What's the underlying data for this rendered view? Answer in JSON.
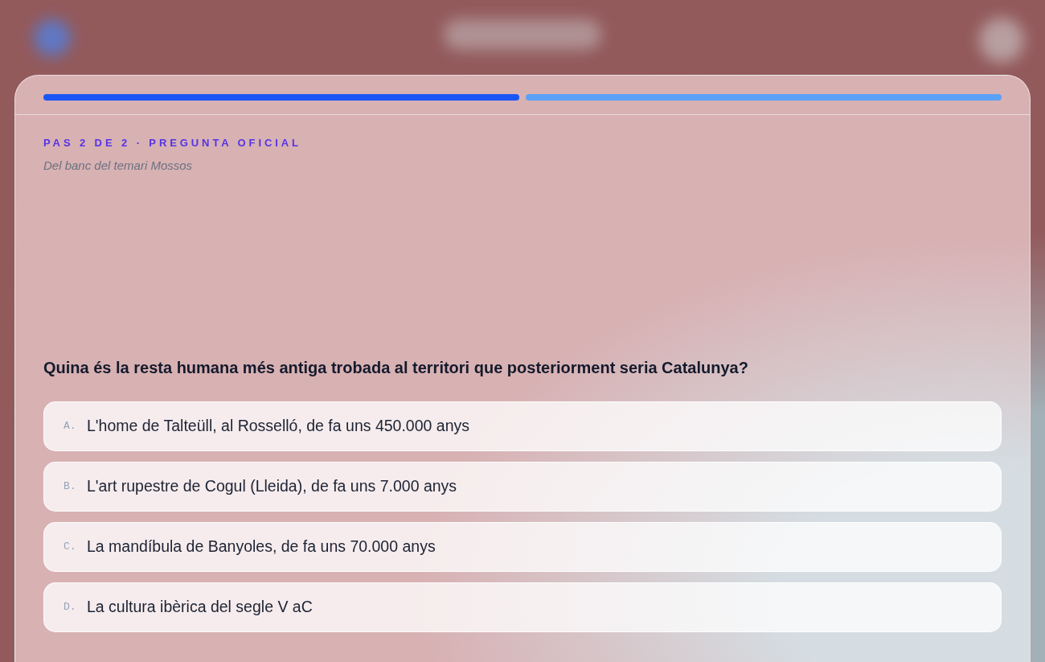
{
  "progress": {
    "steps": [
      {
        "current": false
      },
      {
        "current": true
      }
    ]
  },
  "step_label": "PAS 2 DE 2 · PREGUNTA OFICIAL",
  "source": "Del banc del temari Mossos",
  "question": "Quina és la resta humana més antiga trobada al territori que posteriorment seria Catalunya?",
  "options": [
    {
      "letter": "A.",
      "text": "L'home de Talteüll, al Rosselló, de fa uns 450.000 anys",
      "selected": false
    },
    {
      "letter": "B.",
      "text": "L'art rupestre de Cogul (Lleida), de fa uns 7.000 anys",
      "selected": false
    },
    {
      "letter": "C.",
      "text": "La mandíbula de Banyoles, de fa uns 70.000 anys",
      "selected": false
    },
    {
      "letter": "D.",
      "text": "La cultura ibèrica del segle V aC",
      "selected": false
    }
  ]
}
